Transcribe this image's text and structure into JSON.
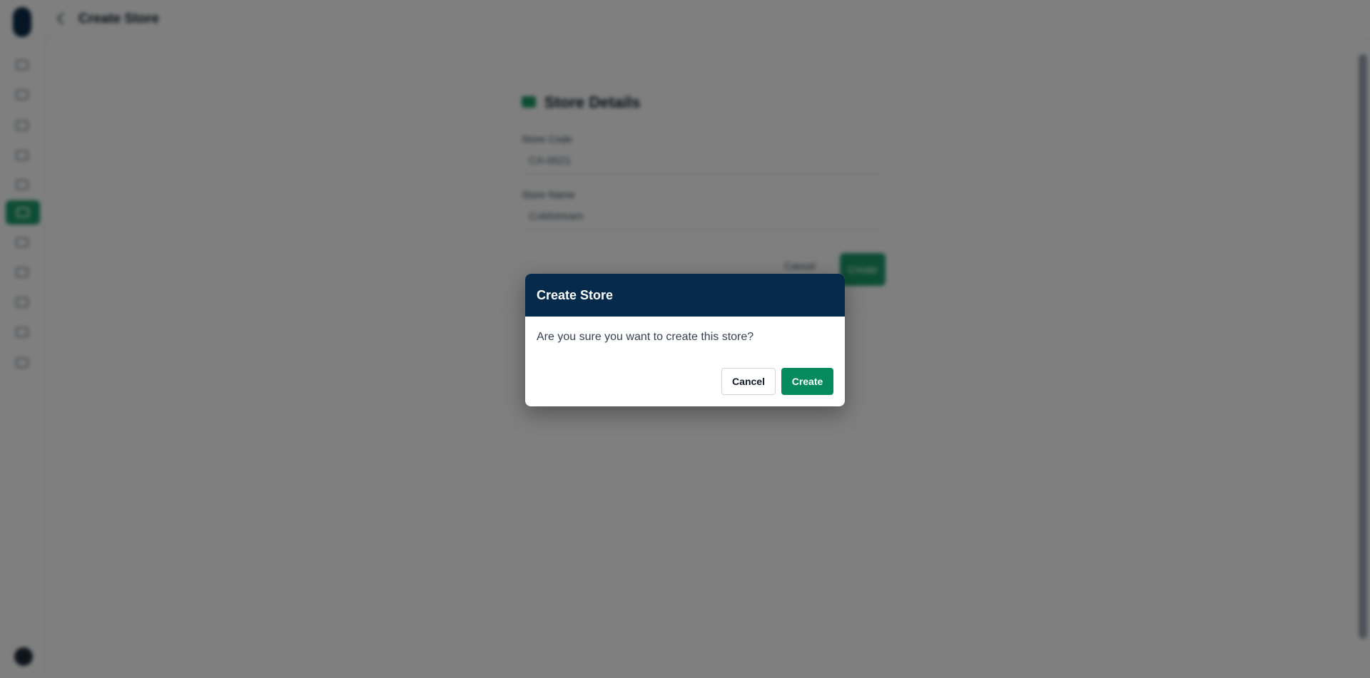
{
  "background": {
    "page_title": "Create Store",
    "card": {
      "title": "Store Details",
      "fields": [
        {
          "label": "Store Code",
          "value": "CA-0021"
        },
        {
          "label": "Store Name",
          "value": "Coldstream"
        }
      ],
      "cancel_label": "Cancel",
      "create_label": "Create"
    },
    "sidebar_icons": [
      "home-icon",
      "dashboard-icon",
      "grid-icon",
      "orders-icon",
      "list-icon",
      "store-icon",
      "users-icon",
      "tag-icon",
      "reports-icon",
      "settings-icon",
      "help-icon"
    ]
  },
  "modal": {
    "title": "Create Store",
    "message": "Are you sure you want to create this store?",
    "cancel_label": "Cancel",
    "create_label": "Create"
  },
  "colors": {
    "modal_header": "#062b4a",
    "primary": "#058a5e"
  }
}
